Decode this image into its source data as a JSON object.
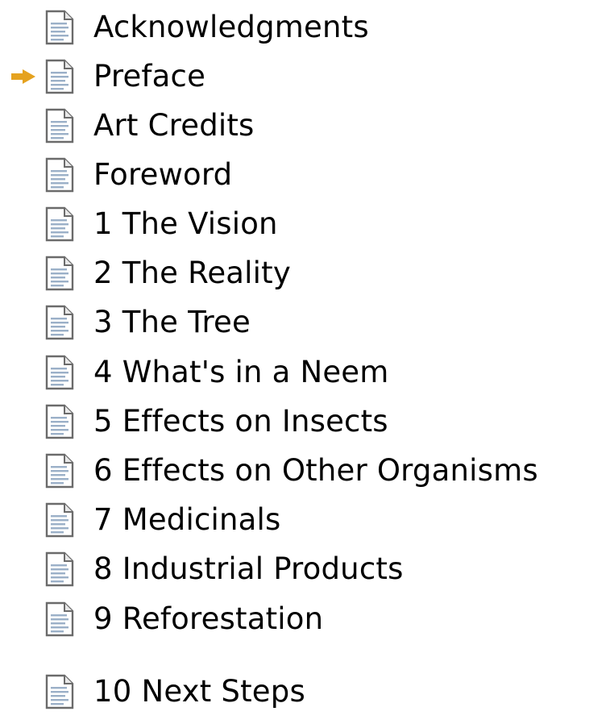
{
  "toc": {
    "current_index": 1,
    "items": [
      {
        "label": "Acknowledgments"
      },
      {
        "label": "Preface"
      },
      {
        "label": "Art Credits"
      },
      {
        "label": "Foreword"
      },
      {
        "label": "1 The Vision"
      },
      {
        "label": "2 The Reality"
      },
      {
        "label": "3 The Tree"
      },
      {
        "label": "4 What's in a Neem"
      },
      {
        "label": "5 Effects on Insects"
      },
      {
        "label": "6 Effects on Other Organisms"
      },
      {
        "label": "7 Medicinals"
      },
      {
        "label": "8 Industrial Products"
      },
      {
        "label": "9 Reforestation"
      },
      {
        "label": "10 Next Steps"
      }
    ],
    "icons": {
      "item_icon": "document-page-icon",
      "current_marker": "arrow-right-icon"
    },
    "colors": {
      "arrow": "#e5a21f",
      "text": "#000000"
    }
  }
}
